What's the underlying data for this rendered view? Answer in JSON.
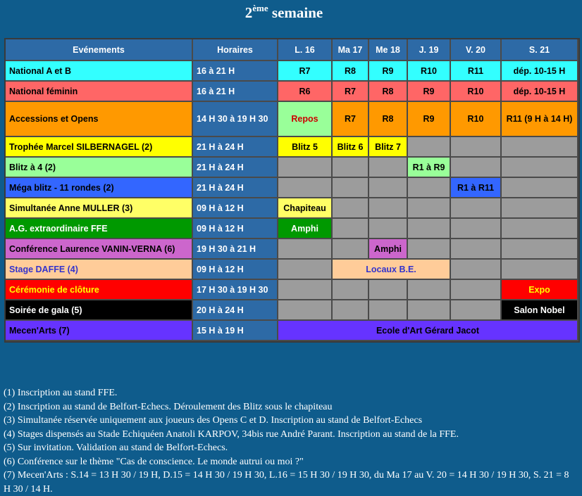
{
  "title": {
    "main": "2",
    "sup": "ème",
    "rest": " semaine"
  },
  "header": {
    "events": "Evénements",
    "hours": "Horaires",
    "days": [
      "L. 16",
      "Ma 17",
      "Me 18",
      "J. 19",
      "V. 20",
      "S. 21"
    ]
  },
  "rows": [
    {
      "event": "National A et B",
      "color": "#33ffff",
      "hours": "16 à 21 H",
      "days": [
        "R7",
        "R8",
        "R9",
        "R10",
        "R11",
        "dép. 10-15 H"
      ]
    },
    {
      "event": "National féminin",
      "color": "#ff6666",
      "hours": "16 à 21 H",
      "days": [
        "R6",
        "R7",
        "R8",
        "R9",
        "R10",
        "dép. 10-15 H"
      ]
    },
    {
      "event": "Accessions et Opens",
      "color": "#ff9900",
      "hours": "14 H 30 à 19 H 30",
      "day1": "Repos",
      "days": [
        "R7",
        "R8",
        "R9",
        "R10",
        "R11 (9 H à 14 H)"
      ]
    },
    {
      "event": "Trophée Marcel SILBERNAGEL (2)",
      "color": "#ffff00",
      "hours": "21 H à 24 H",
      "days": [
        "Blitz 5",
        "Blitz 6",
        "Blitz 7"
      ]
    },
    {
      "event": "Blitz à 4 (2)",
      "color": "#99ff99",
      "hours": "21 H à 24 H",
      "cell": "R1 à R9"
    },
    {
      "event": "Méga blitz - 11 rondes (2)",
      "color": "#3366ff",
      "hours": "21 H à 24 H",
      "cell": "R1 à R11"
    },
    {
      "event": "Simultanée Anne MULLER (3)",
      "color": "#ffff66",
      "hours": "09 H à 12 H",
      "cell": "Chapiteau"
    },
    {
      "event": "A.G. extraordinaire FFE",
      "color": "#009900",
      "hours": "09 H à 12 H",
      "cell": "Amphi"
    },
    {
      "event": "Conférence Laurence VANIN-VERNA (6)",
      "color": "#cc66cc",
      "hours": "19 H 30 à 21 H",
      "cell": "Amphi"
    },
    {
      "event": "Stage DAFFE (4)",
      "color": "#ffcc99",
      "text_color": "#3333cc",
      "hours": "09 H à 12 H",
      "cell": "Locaux B.E."
    },
    {
      "event": "Cérémonie de clôture",
      "color": "#ff0000",
      "text_color": "#ffff00",
      "hours": "17 H 30 à 19 H 30",
      "cell": "Expo"
    },
    {
      "event": "Soirée de gala (5)",
      "color": "#000000",
      "text_color": "#ffffff",
      "hours": "20 H à 24 H",
      "cell": "Salon Nobel"
    },
    {
      "event": "Mecen'Arts (7)",
      "color": "#6633ff",
      "hours": "15 H à 19 H",
      "cell": "Ecole d'Art Gérard Jacot"
    }
  ],
  "notes": [
    "(1) Inscription au stand FFE.",
    "(2) Inscription au stand de Belfort-Echecs. Déroulement des Blitz sous le chapiteau",
    "(3) Simultanée réservée uniquement aux joueurs des Opens C et D. Inscription au stand de Belfort-Echecs",
    "(4) Stages dispensés au Stade Echiquéen Anatoli KARPOV, 34bis rue André Parant. Inscription au stand de la FFE.",
    "(5) Sur invitation. Validation au stand de Belfort-Echecs.",
    "(6) Conférence sur le thème \"Cas de conscience. Le monde autrui ou moi ?\"",
    "(7) Mecen'Arts : S.14 = 13 H 30 / 19 H, D.15 = 14 H 30 / 19 H 30, L.16 = 15 H 30 / 19 H 30, du Ma 17 au V. 20 = 14 H 30 / 19 H 30, S. 21 = 8 H 30 / 14 H."
  ]
}
